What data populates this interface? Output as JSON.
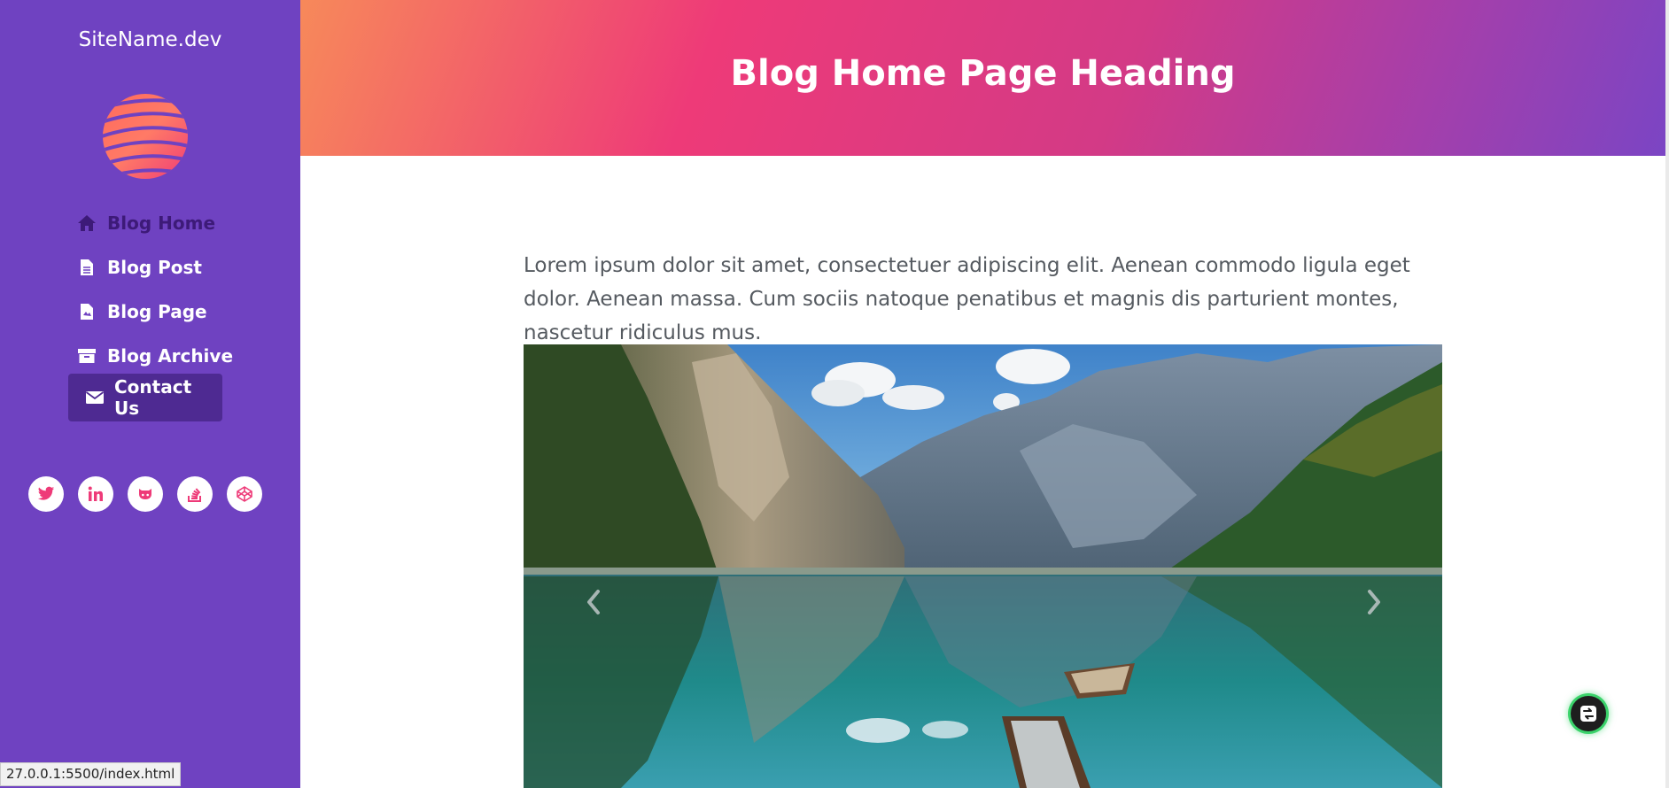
{
  "sidebar": {
    "site_name": "SiteName.dev",
    "logo_icon": "striped-globe-logo",
    "nav": [
      {
        "label": "Blog Home",
        "icon": "home-icon",
        "active": true
      },
      {
        "label": "Blog Post",
        "icon": "document-icon"
      },
      {
        "label": "Blog Page",
        "icon": "page-icon"
      },
      {
        "label": "Blog Archive",
        "icon": "archive-icon"
      },
      {
        "label": "Contact Us",
        "icon": "envelope-icon",
        "highlighted": true
      }
    ],
    "socials": [
      "twitter-icon",
      "linkedin-icon",
      "github-icon",
      "stackoverflow-icon",
      "codepen-icon"
    ]
  },
  "header": {
    "title": "Blog Home Page Heading"
  },
  "main": {
    "intro": "Lorem ipsum dolor sit amet, consectetuer adipiscing elit. Aenean commodo ligula eget dolor. Aenean massa. Cum sociis natoque penatibus et magnis dis parturient montes, nascetur ridiculus mus.",
    "carousel": {
      "image": "mountain-lake-with-rowboats",
      "prev_icon": "chevron-left-icon",
      "next_icon": "chevron-right-icon"
    }
  },
  "status_bar": {
    "url": "27.0.0.1:5500/index.html"
  },
  "floating_button": {
    "icon": "live-server-icon"
  },
  "colors": {
    "sidebar": "#6f42c1",
    "active_nav": "#3d1a78",
    "contact_bg": "#4e2a92",
    "accent": "#ee3a78",
    "header_gradient_start": "#f7895a",
    "header_gradient_end": "#7b45c4"
  }
}
